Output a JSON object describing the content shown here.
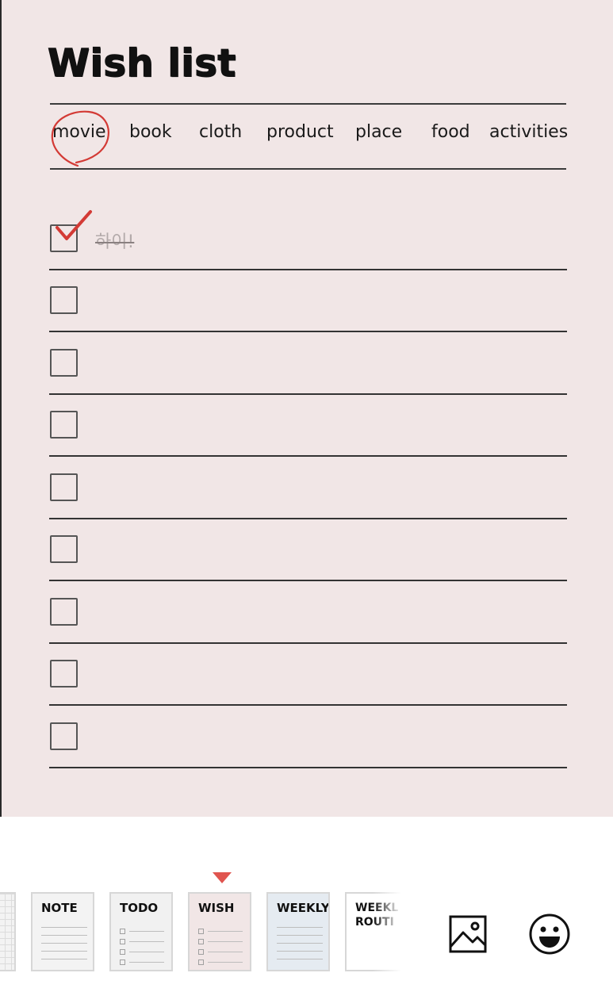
{
  "wish_list": {
    "title": "Wish list",
    "categories": [
      {
        "label": "movie",
        "selected": true
      },
      {
        "label": "book"
      },
      {
        "label": "cloth"
      },
      {
        "label": "product"
      },
      {
        "label": "place"
      },
      {
        "label": "food"
      },
      {
        "label": "activities"
      }
    ],
    "items": [
      {
        "text": "하이!",
        "checked": true
      },
      {
        "text": "",
        "checked": false
      },
      {
        "text": "",
        "checked": false
      },
      {
        "text": "",
        "checked": false
      },
      {
        "text": "",
        "checked": false
      },
      {
        "text": "",
        "checked": false
      },
      {
        "text": "",
        "checked": false
      },
      {
        "text": "",
        "checked": false
      },
      {
        "text": "",
        "checked": false
      }
    ]
  },
  "template_bar": {
    "templates": [
      {
        "label": "NOTE",
        "icon": "note-lines"
      },
      {
        "label": "TODO",
        "icon": "todo-checklist"
      },
      {
        "label": "WISH",
        "icon": "wish-checklist",
        "selected": true
      },
      {
        "label": "WEEKLY",
        "icon": "weekly-lines"
      },
      {
        "label": "WEEKL ROUTI",
        "icon": "weekly-routine"
      }
    ],
    "tools": [
      {
        "name": "image-icon"
      },
      {
        "name": "emoji-icon"
      }
    ]
  },
  "colors": {
    "canvas_bg": "#f1e6e6",
    "accent_red": "#e0554f",
    "check_red": "#d33a35",
    "wish_thumb_bg": "#f1e6e6",
    "weekly_thumb_bg": "#e5ebf1",
    "note_thumb_bg": "#f3f3f3",
    "todo_thumb_bg": "#f1f1f1"
  }
}
